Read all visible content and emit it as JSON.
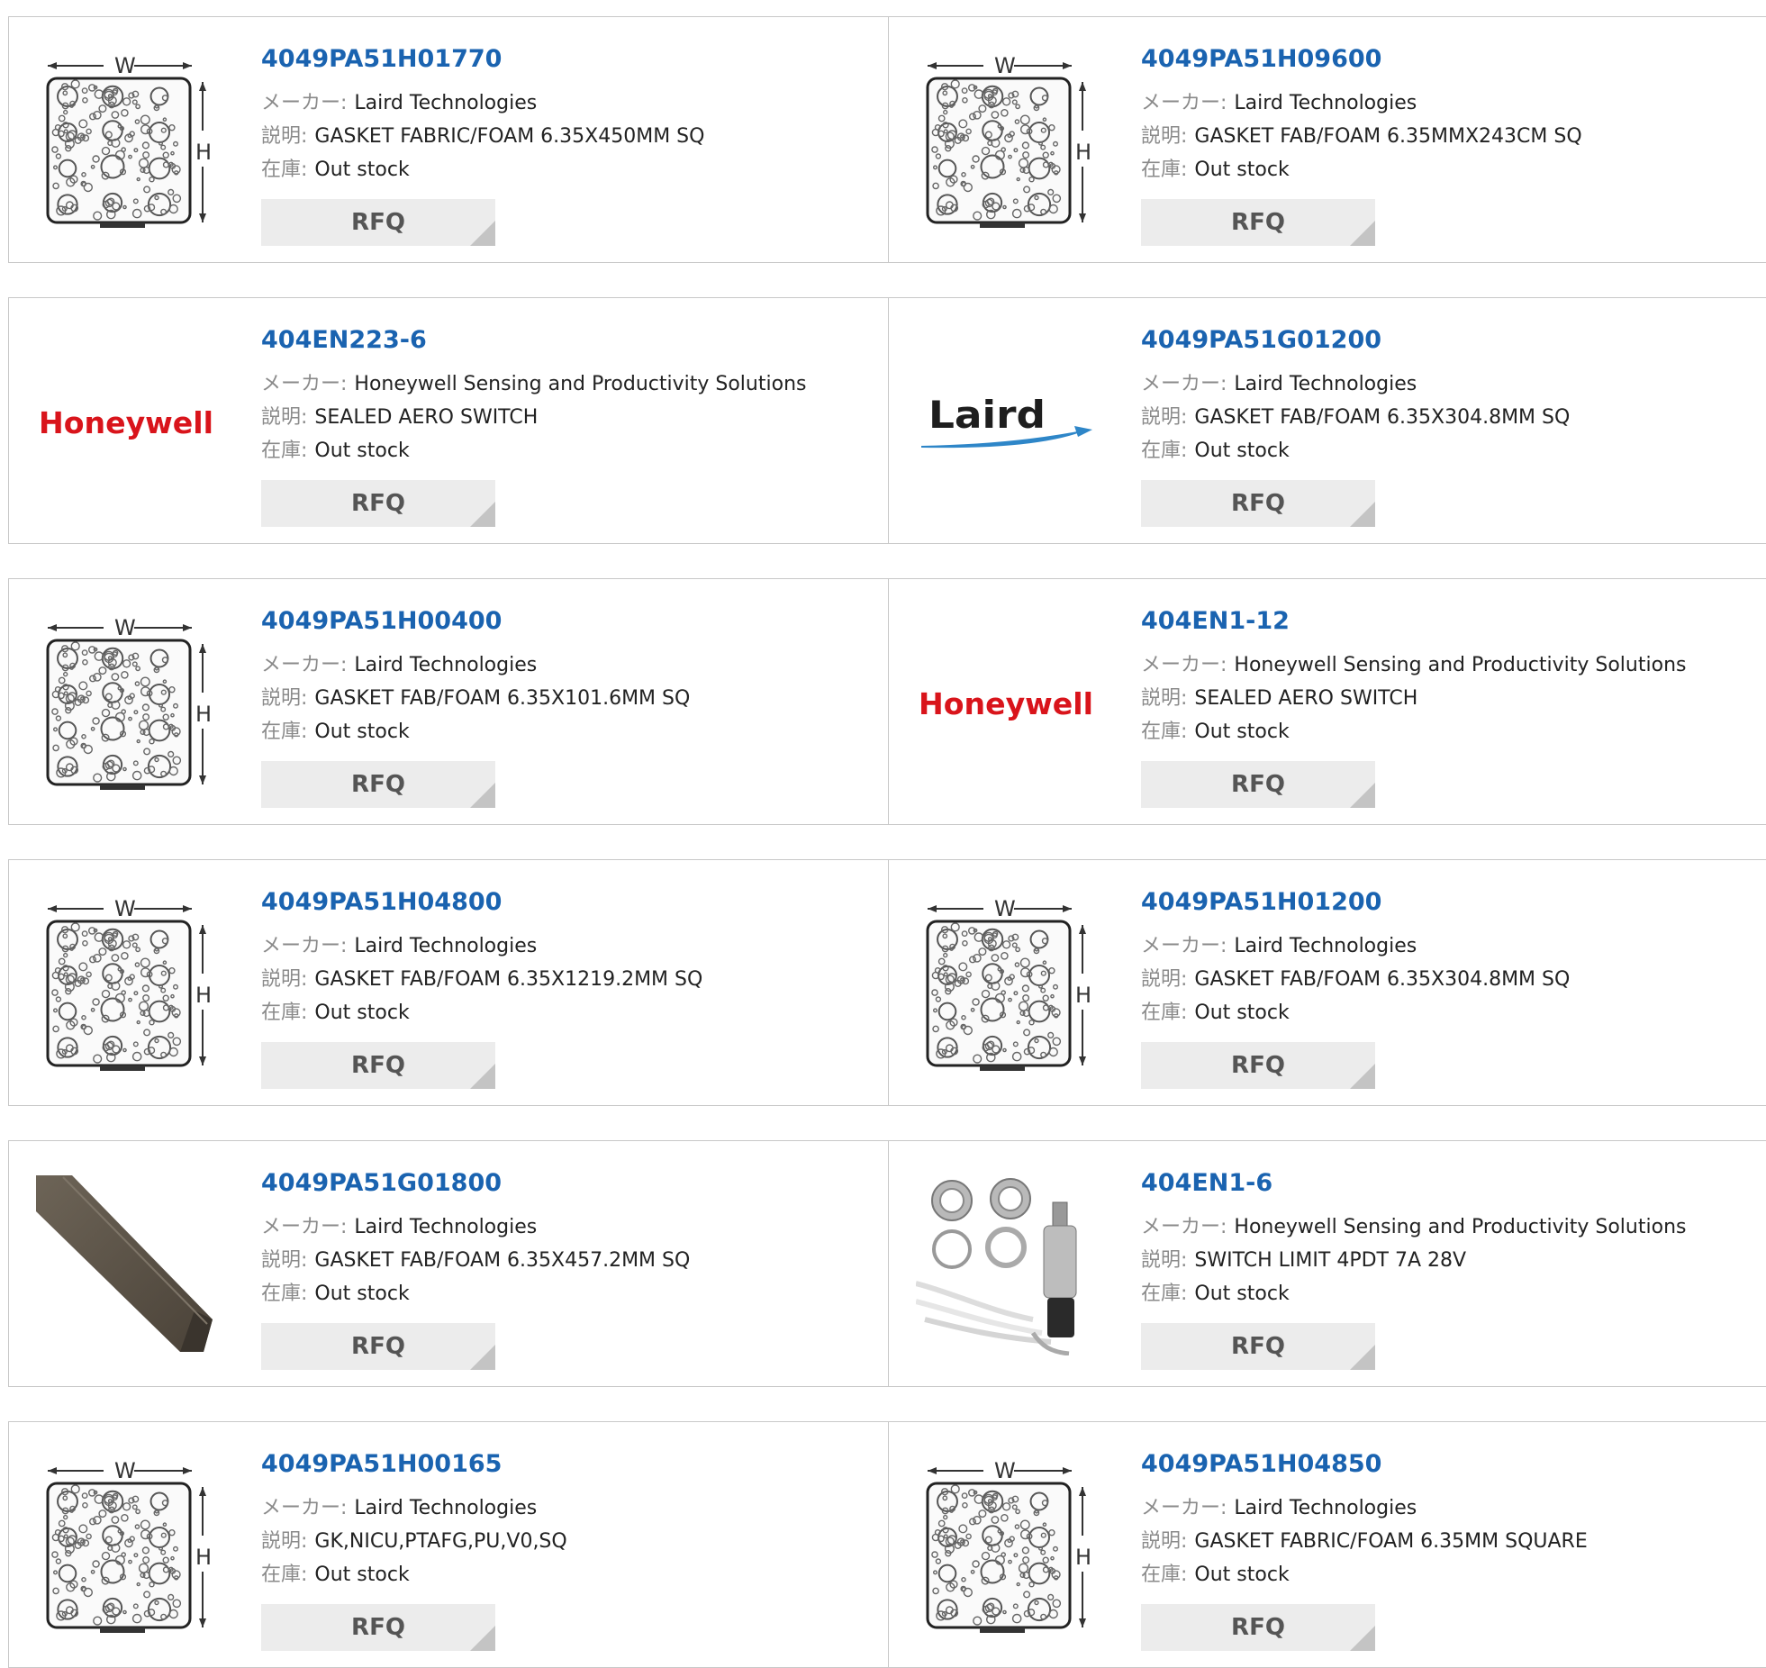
{
  "labels": {
    "maker": "メーカー:",
    "desc": "説明:",
    "stock": "在庫:",
    "rfq": "RFQ"
  },
  "brand_logos": {
    "honeywell": "Honeywell",
    "laird": "Laird"
  },
  "products": [
    {
      "part": "4049PA51H01770",
      "maker": "Laird Technologies",
      "desc": "GASKET FABRIC/FOAM 6.35X450MM SQ",
      "stock": "Out stock",
      "image": "gasket-diagram"
    },
    {
      "part": "4049PA51H09600",
      "maker": "Laird Technologies",
      "desc": "GASKET FAB/FOAM 6.35MMX243CM SQ",
      "stock": "Out stock",
      "image": "gasket-diagram"
    },
    {
      "part": "404EN223-6",
      "maker": "Honeywell Sensing and Productivity Solutions",
      "desc": "SEALED AERO SWITCH",
      "stock": "Out stock",
      "image": "honeywell-logo"
    },
    {
      "part": "4049PA51G01200",
      "maker": "Laird Technologies",
      "desc": "GASKET FAB/FOAM 6.35X304.8MM SQ",
      "stock": "Out stock",
      "image": "laird-logo"
    },
    {
      "part": "4049PA51H00400",
      "maker": "Laird Technologies",
      "desc": "GASKET FAB/FOAM 6.35X101.6MM SQ",
      "stock": "Out stock",
      "image": "gasket-diagram"
    },
    {
      "part": "404EN1-12",
      "maker": "Honeywell Sensing and Productivity Solutions",
      "desc": "SEALED AERO SWITCH",
      "stock": "Out stock",
      "image": "honeywell-logo"
    },
    {
      "part": "4049PA51H04800",
      "maker": "Laird Technologies",
      "desc": "GASKET FAB/FOAM 6.35X1219.2MM SQ",
      "stock": "Out stock",
      "image": "gasket-diagram"
    },
    {
      "part": "4049PA51H01200",
      "maker": "Laird Technologies",
      "desc": "GASKET FAB/FOAM 6.35X304.8MM SQ",
      "stock": "Out stock",
      "image": "gasket-diagram"
    },
    {
      "part": "4049PA51G01800",
      "maker": "Laird Technologies",
      "desc": "GASKET FAB/FOAM 6.35X457.2MM SQ",
      "stock": "Out stock",
      "image": "gasket-strip-photo"
    },
    {
      "part": "404EN1-6",
      "maker": "Honeywell Sensing and Productivity Solutions",
      "desc": "SWITCH LIMIT 4PDT 7A 28V",
      "stock": "Out stock",
      "image": "limit-switch-photo"
    },
    {
      "part": "4049PA51H00165",
      "maker": "Laird Technologies",
      "desc": "GK,NICU,PTAFG,PU,V0,SQ",
      "stock": "Out stock",
      "image": "gasket-diagram"
    },
    {
      "part": "4049PA51H04850",
      "maker": "Laird Technologies",
      "desc": "GASKET FABRIC/FOAM 6.35MM SQUARE",
      "stock": "Out stock",
      "image": "gasket-diagram"
    }
  ],
  "colors": {
    "part_link": "#1a63b0",
    "honeywell_red": "#d9141b",
    "laird_blue": "#2e86c8",
    "rfq_bg": "#ececec"
  }
}
